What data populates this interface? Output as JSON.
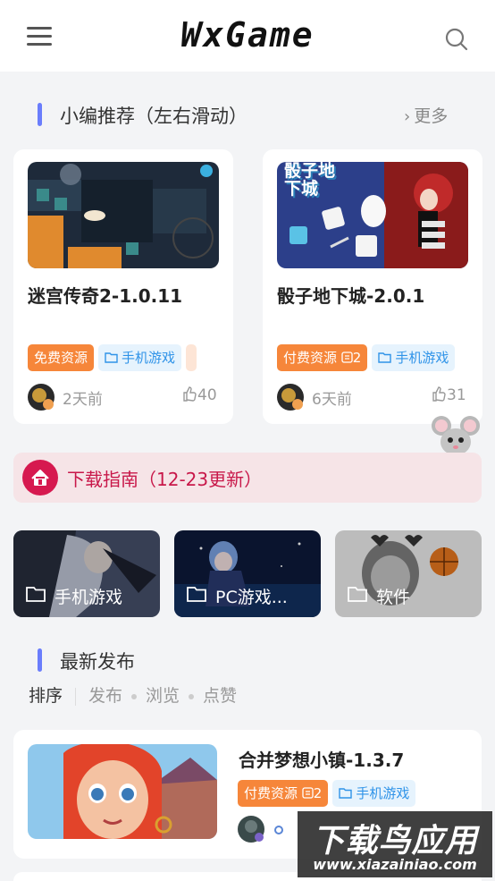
{
  "header": {
    "logo": "WxGame"
  },
  "recommend": {
    "title": "小编推荐（左右滑动）",
    "more": "更多",
    "cards": [
      {
        "title": "迷宫传奇2-1.0.11",
        "tag1": "免费资源",
        "tag2": "手机游戏",
        "time": "2天前",
        "likes": "40"
      },
      {
        "title": "骰子地下城-2.0.1",
        "tag1": "付费资源",
        "tag1_count": "2",
        "tag2": "手机游戏",
        "time": "6天前",
        "likes": "31",
        "thumb_text": "骰子地下城"
      }
    ]
  },
  "guide": {
    "text": "下载指南（12-23更新）"
  },
  "categories": [
    {
      "label": "手机游戏"
    },
    {
      "label": "PC游戏..."
    },
    {
      "label": "软件"
    }
  ],
  "latest": {
    "title": "最新发布",
    "sort_label": "排序",
    "sort_options": [
      "发布",
      "浏览",
      "点赞"
    ]
  },
  "post": {
    "title": "合并梦想小镇-1.3.7",
    "tag1": "付费资源",
    "tag1_count": "2",
    "tag2": "手机游戏"
  },
  "watermark": {
    "main": "下载鸟应用",
    "url": "www.xiazainiao.com"
  },
  "colors": {
    "accent": "#6a7dfc",
    "orange": "#f6863a",
    "blue": "#2f93e8",
    "guide": "#c8184a"
  }
}
